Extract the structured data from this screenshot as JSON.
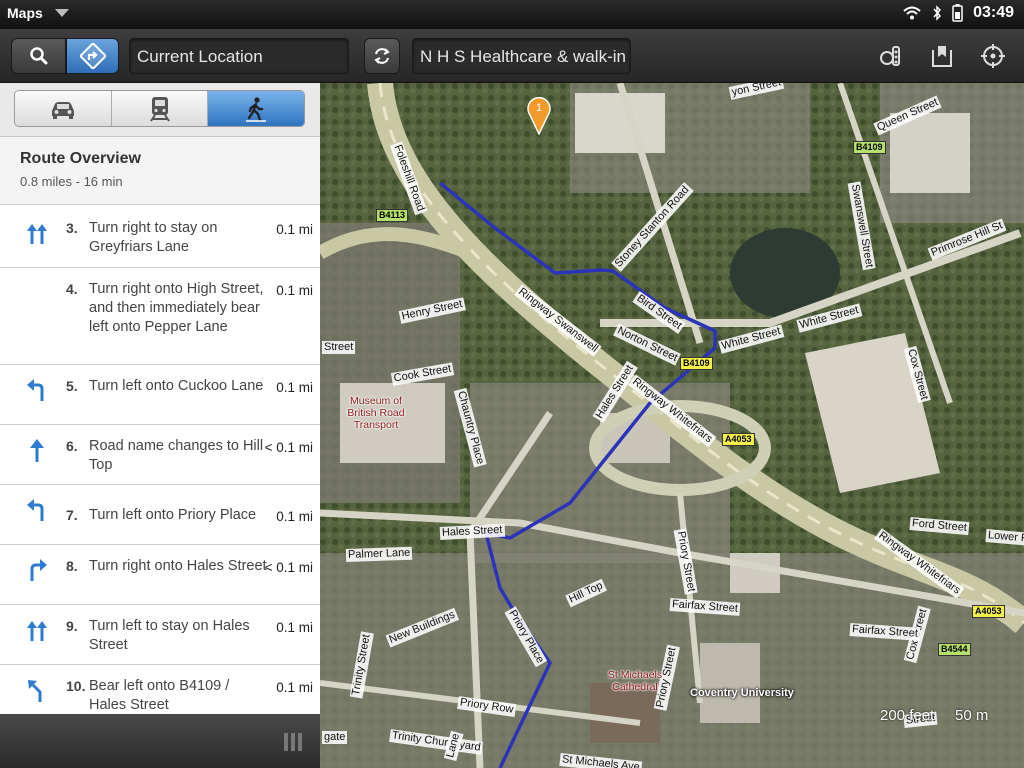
{
  "status": {
    "app_name": "Maps",
    "time": "03:49"
  },
  "toolbar": {
    "from": "Current Location",
    "to": "N H S Healthcare & walk-in Ce",
    "search_icon": "search-icon",
    "directions_icon": "directions-icon"
  },
  "modes": [
    "car",
    "transit",
    "walk"
  ],
  "route_overview": {
    "title": "Route Overview",
    "summary": "0.8 miles - 16 min"
  },
  "steps": [
    {
      "num": "3.",
      "text": "Turn right to stay on Greyfriars Lane",
      "dist": "0.1 mi",
      "icon": "keep-right-icon"
    },
    {
      "num": "4.",
      "text": "Turn right onto High Street, and then immediately bear left onto Pepper Lane",
      "dist": "0.1 mi",
      "icon": ""
    },
    {
      "num": "5.",
      "text": "Turn left onto Cuckoo Lane",
      "dist": "0.1 mi",
      "icon": "turn-left-icon"
    },
    {
      "num": "6.",
      "text": "Road name changes to Hill Top",
      "dist": "< 0.1 mi",
      "icon": "straight-icon"
    },
    {
      "num": "7.",
      "text": "Turn left onto Priory Place",
      "dist": "0.1 mi",
      "icon": "turn-left-icon"
    },
    {
      "num": "8.",
      "text": "Turn right onto Hales Street",
      "dist": "< 0.1 mi",
      "icon": "turn-right-icon"
    },
    {
      "num": "9.",
      "text": "Turn left to stay on Hales Street",
      "dist": "0.1 mi",
      "icon": "keep-left-icon"
    },
    {
      "num": "10.",
      "text": "Bear left onto B4109 / Hales Street",
      "dist": "0.1 mi",
      "icon": "bear-left-icon"
    }
  ],
  "map": {
    "pin_label": "1",
    "streets": [
      "Foleshill Road",
      "Stoney Stanton Road",
      "Ringway Swanswell",
      "Bird Street",
      "Norton Street",
      "White Street",
      "Henry Street",
      "Cook Street",
      "Chauntry Place",
      "Hales Street",
      "Ringway Whitefriars",
      "Queen Street",
      "Swanswell Street",
      "Primrose Hill St",
      "Cox Street",
      "Ford Street",
      "Lower F",
      "Priory Street",
      "Fairfax Street",
      "Palmer Lane",
      "Hill Top",
      "New Buildings",
      "Priory Place",
      "Priory Row",
      "Trinity Street",
      "Trinity Churchyard",
      "St Michaels Ave",
      "Street",
      "Lane",
      "Street",
      "gate",
      "yon Street"
    ],
    "shields": [
      "B4113",
      "B4109",
      "B4109",
      "A4053",
      "A4053",
      "B4544"
    ],
    "pois": [
      "Museum of British Road Transport",
      "St Michaels Cathedral"
    ],
    "university": "Coventry University",
    "scale": "200 feet     50 m"
  }
}
